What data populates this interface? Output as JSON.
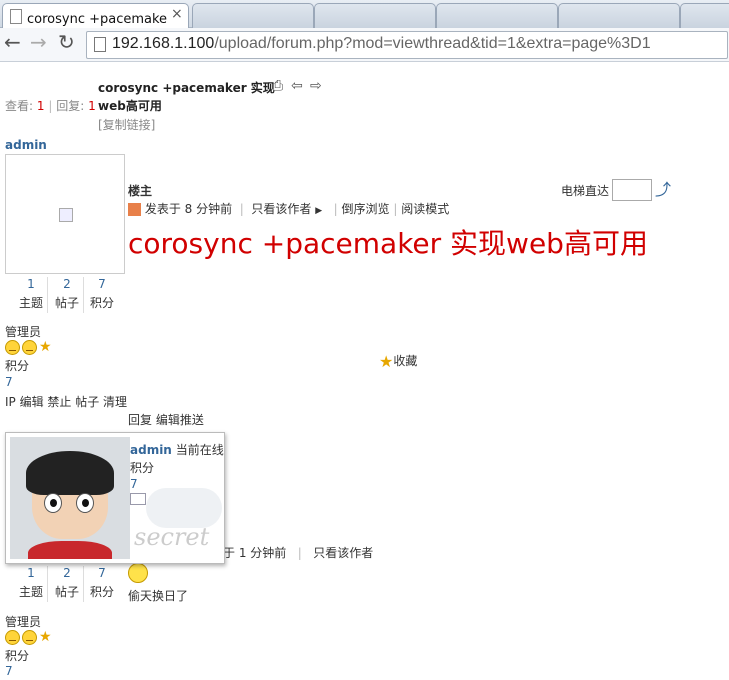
{
  "browser": {
    "tab_title": "corosync +pacemaker 实现",
    "url_host": "192.168.1.100",
    "url_rest": "/upload/forum.php?mod=viewthread&tid=1&extra=page%3D1"
  },
  "thread": {
    "views_label": "查看:",
    "views": "1",
    "replies_label": "回复:",
    "replies": "1",
    "title_line1": "corosync +pacemaker 实现",
    "title_line2": "web高可用",
    "copy_link": "[复制链接]",
    "big_title": "corosync +pacemaker 实现web高可用",
    "elevator_label": "电梯直达"
  },
  "post1": {
    "author": "admin",
    "floor": "楼主",
    "posted": "发表于 8 分钟前",
    "only_author": "只看该作者",
    "reverse": "倒序浏览",
    "read_mode": "阅读模式",
    "stats": [
      {
        "value": "1",
        "label": "主题"
      },
      {
        "value": "2",
        "label": "帖子"
      },
      {
        "value": "7",
        "label": "积分"
      }
    ],
    "group": "管理员",
    "points_label": "积分",
    "points": "7",
    "admin_links": "IP 编辑 禁止 帖子 清理",
    "favorite": "收藏",
    "reply_links": "回复 编辑推送"
  },
  "popup": {
    "name": "admin",
    "status": "当前在线",
    "points_label": "积分",
    "points": "7",
    "watermark": "secret"
  },
  "post2": {
    "posted_suffix": "于 1 分钟前",
    "only_author": "只看该作者",
    "stats": [
      {
        "value": "1",
        "label": "主题"
      },
      {
        "value": "2",
        "label": "帖子"
      },
      {
        "value": "7",
        "label": "积分"
      }
    ],
    "content": "偷天换日了",
    "group": "管理员",
    "points_label": "积分",
    "points": "7"
  }
}
